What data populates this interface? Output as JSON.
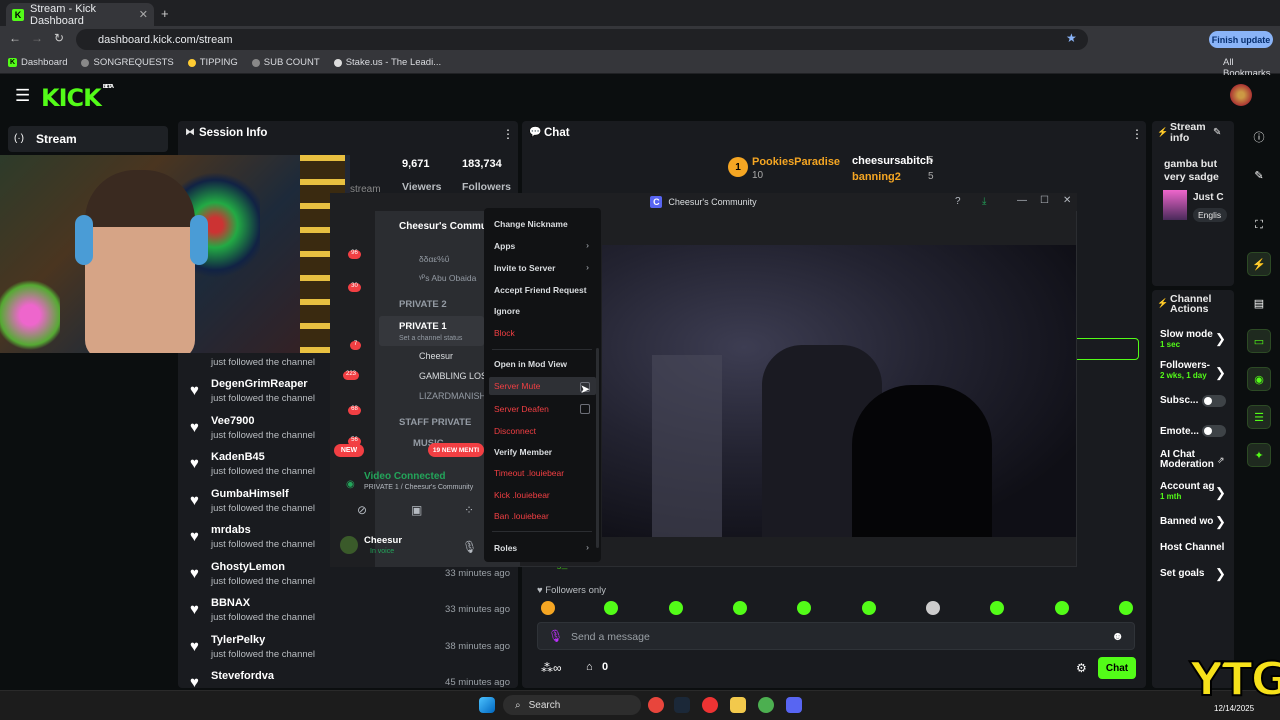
{
  "browser": {
    "tab_title": "Stream - Kick Dashboard",
    "url": "dashboard.kick.com/stream",
    "finish_update": "Finish update",
    "bookmarks": [
      "Dashboard",
      "SONGREQUESTS",
      "TIPPING",
      "SUB COUNT",
      "Stake.us - The Leadi..."
    ],
    "all_bookmarks": "All Bookmarks"
  },
  "kick": {
    "logo": "KICK",
    "beta": "BETA"
  },
  "left_nav": {
    "stream": "Stream"
  },
  "session": {
    "title": "Session Info",
    "viewers_count": "9,671",
    "viewers_label": "Viewers",
    "followers_count": "183,734",
    "followers_label": "Followers",
    "stream_partial": "stream"
  },
  "followers_list": [
    {
      "name": "",
      "sub": "just followed the channel",
      "time": ""
    },
    {
      "name": "DegenGrimReaper",
      "sub": "just followed the channel",
      "time": ""
    },
    {
      "name": "Vee7900",
      "sub": "just followed the channel",
      "time": ""
    },
    {
      "name": "KadenB45",
      "sub": "just followed the channel",
      "time": ""
    },
    {
      "name": "GumbaHimself",
      "sub": "just followed the channel",
      "time": ""
    },
    {
      "name": "mrdabs",
      "sub": "just followed the channel",
      "time": ""
    },
    {
      "name": "GhostyLemon",
      "sub": "just followed the channel",
      "time": "33 minutes ago"
    },
    {
      "name": "BBNAX",
      "sub": "just followed the channel",
      "time": "33 minutes ago"
    },
    {
      "name": "TylerPelky",
      "sub": "just followed the channel",
      "time": "38 minutes ago"
    },
    {
      "name": "Stevefordva",
      "sub": "",
      "time": "45 minutes ago"
    }
  ],
  "chat": {
    "title": "Chat",
    "leader1": "PookiesParadise",
    "leader1_count": "10",
    "leader2": "cheesursabitch",
    "leader2_count": "5",
    "leader3": "banning2",
    "leader3_count": "5",
    "followers_only": "Followers only",
    "input_placeholder": "Send a message",
    "chat_button": "Chat",
    "count": "0",
    "partial_user": "Yung_LTT"
  },
  "discord": {
    "window_title": "Cheesur's Community",
    "server_name": "Cheesur's Community",
    "channels": [
      "PRIVATE 2",
      "PRIVATE 1",
      "STAFF PRIVATE",
      "MUSIC"
    ],
    "channel_status": "Set a channel status",
    "voice_users": [
      "Cheesur",
      "GAMBLING LOSE",
      "LIZARDMANISHE"
    ],
    "top_users": [
      "δδαε%ΰ",
      "ᵞᴾs Abu Obaida"
    ],
    "new_badge": "NEW",
    "mentions": "19 NEW MENTI",
    "video_connected": "Video Connected",
    "video_sub": "PRIVATE 1 / Cheesur's Community",
    "user_name": "Cheesur",
    "user_status": "In voice",
    "badges": [
      "96",
      "30",
      "7",
      "223",
      "68",
      "56"
    ]
  },
  "context_menu": {
    "items": [
      "Change Nickname",
      "Apps",
      "Invite to Server",
      "Accept Friend Request",
      "Ignore",
      "Block",
      "Open in Mod View",
      "Server Mute",
      "Server Deafen",
      "Disconnect",
      "Verify Member",
      "Timeout .louiebear",
      "Kick .louiebear",
      "Ban .louiebear",
      "Roles"
    ]
  },
  "stream_info": {
    "title": "Stream info",
    "stream_title": "gamba but very sadge",
    "category_partial": "Just C",
    "lang_partial": "Englis"
  },
  "channel_actions": {
    "title": "Channel Actions",
    "slow_mode": "Slow mode",
    "slow_mode_val": "1 sec",
    "followers": "Followers-",
    "followers_val": "2 wks, 1 day",
    "subs": "Subsc...",
    "emotes": "Emote...",
    "ai": "AI Chat Moderation",
    "account_age": "Account ag",
    "account_age_val": "1 mth",
    "banned": "Banned wo",
    "host": "Host Channel",
    "goals": "Set goals"
  },
  "taskbar": {
    "search": "Search",
    "date": "12/14/2025"
  },
  "watermark": "YTG",
  "colors": {
    "kick_green": "#53fc18",
    "discord_red": "#f23f43",
    "panel": "#191b1f",
    "bg": "#0b0e0f"
  }
}
